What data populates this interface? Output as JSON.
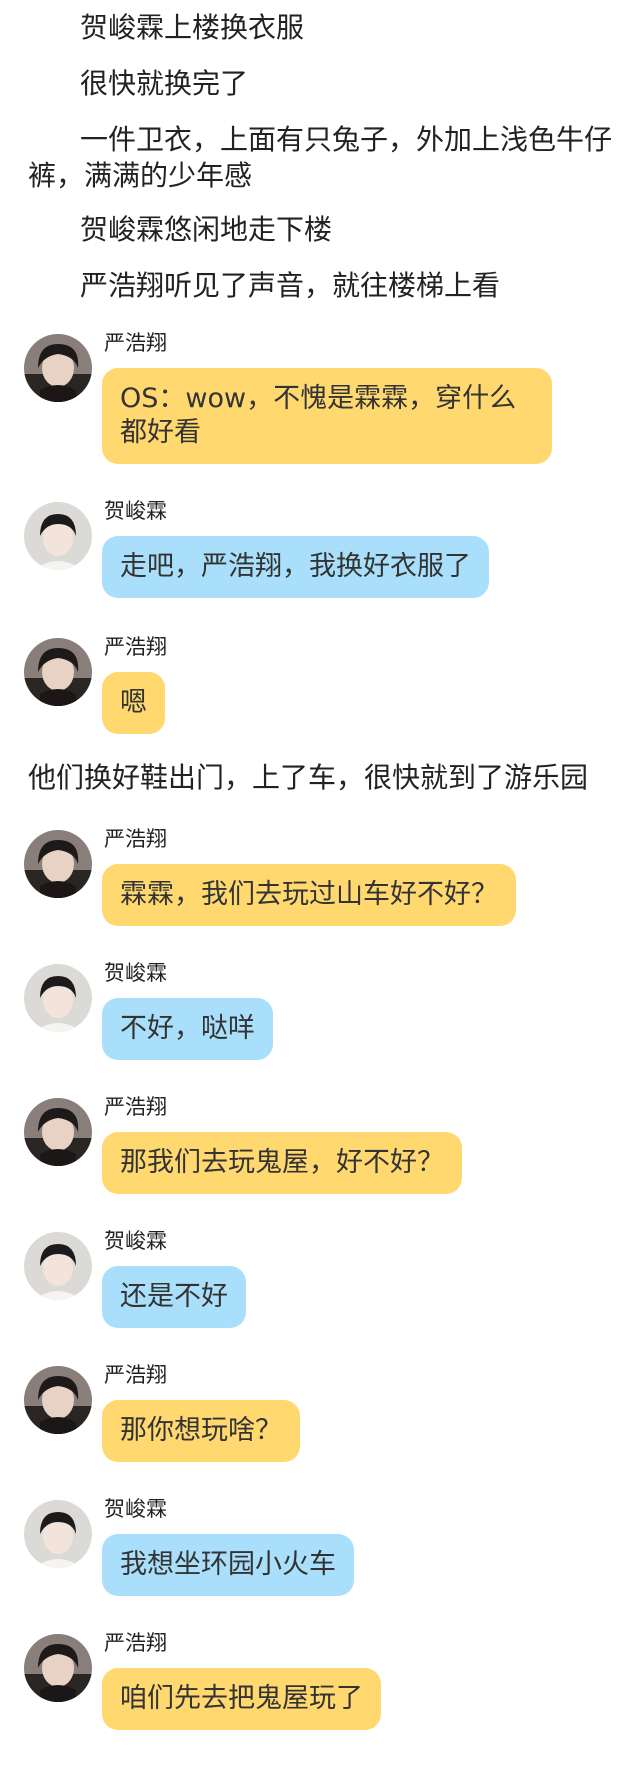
{
  "narration": [
    "贺峻霖上楼换衣服",
    "很快就换完了",
    "一件卫衣，上面有只兔子，外加上浅色牛仔裤，满满的少年感",
    "贺峻霖悠闲地走下楼",
    "严浩翔听见了声音，就往楼梯上看"
  ],
  "mid_narration": "他们换好鞋出门，上了车，很快就到了游乐园",
  "senders": {
    "yan": "严浩翔",
    "he": "贺峻霖"
  },
  "colors": {
    "yellow_bubble": "#ffd970",
    "blue_bubble": "#a9dffb"
  },
  "messages": [
    {
      "sender": "严浩翔",
      "avatar": "dark-hair-avatar",
      "text": "OS：wow，不愧是霖霖，穿什么都好看",
      "color": "yellow"
    },
    {
      "sender": "贺峻霖",
      "avatar": "light-avatar",
      "text": "走吧，严浩翔，我换好衣服了",
      "color": "blue"
    },
    {
      "sender": "严浩翔",
      "avatar": "dark-hair-avatar",
      "text": "嗯",
      "color": "yellow"
    },
    {
      "sender": "严浩翔",
      "avatar": "dark-hair-avatar",
      "text": "霖霖，我们去玩过山车好不好？",
      "color": "yellow"
    },
    {
      "sender": "贺峻霖",
      "avatar": "light-avatar",
      "text": "不好，哒咩",
      "color": "blue"
    },
    {
      "sender": "严浩翔",
      "avatar": "dark-hair-avatar",
      "text": "那我们去玩鬼屋，好不好？",
      "color": "yellow"
    },
    {
      "sender": "贺峻霖",
      "avatar": "light-avatar",
      "text": "还是不好",
      "color": "blue"
    },
    {
      "sender": "严浩翔",
      "avatar": "dark-hair-avatar",
      "text": "那你想玩啥？",
      "color": "yellow"
    },
    {
      "sender": "贺峻霖",
      "avatar": "light-avatar",
      "text": "我想坐环园小火车",
      "color": "blue"
    },
    {
      "sender": "严浩翔",
      "avatar": "dark-hair-avatar",
      "text": "咱们先去把鬼屋玩了",
      "color": "yellow"
    }
  ]
}
